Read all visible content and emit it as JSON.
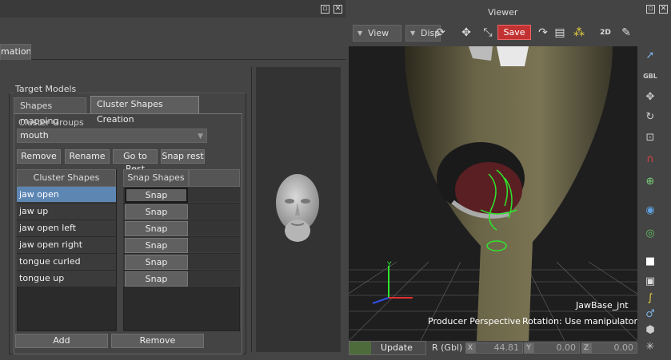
{
  "left_panel": {
    "partial_tab_label": "mation",
    "target_models_title": "Target Models",
    "tabs": [
      {
        "label": "Shapes mapping"
      },
      {
        "label": "Cluster Shapes Creation"
      }
    ],
    "cluster_groups_label": "Cluster Groups",
    "cluster_group_selected": "mouth",
    "action_buttons": [
      {
        "label": "Remove"
      },
      {
        "label": "Rename"
      },
      {
        "label": "Go to Rest"
      },
      {
        "label": "Snap rest"
      }
    ],
    "cluster_shapes_header": "Cluster Shapes",
    "snap_shapes_header": "Snap Shapes",
    "cluster_shapes": [
      {
        "name": "jaw open",
        "snap": "Snap"
      },
      {
        "name": "jaw up",
        "snap": "Snap"
      },
      {
        "name": "jaw open left",
        "snap": "Snap"
      },
      {
        "name": "jaw open right",
        "snap": "Snap"
      },
      {
        "name": "tongue curled",
        "snap": "Snap"
      },
      {
        "name": "tongue up",
        "snap": "Snap"
      }
    ],
    "add_button": "Add",
    "remove_button": "Remove"
  },
  "viewer": {
    "title": "Viewer",
    "view_menu": "View",
    "display_menu": "Disp",
    "save_label": "Save",
    "view_2d_label": "2D",
    "object_label": "JawBase_jnt",
    "camera_label": "Producer Perspective",
    "rotation_label": "Rotation: Use manipulator",
    "update_label": "Update",
    "coord_mode": "R (Gbl)",
    "coords": {
      "x": "44.81",
      "y": "0.00",
      "z": "0.00"
    },
    "axis_labels": {
      "x": "X",
      "y": "Y",
      "z": "Z"
    },
    "gbl_label": "GBL",
    "axis_indicator_label": "Y"
  },
  "colors": {
    "save_red": "#c23232",
    "selection_blue": "#5d86b3",
    "update_green": "#4d6b3b"
  }
}
